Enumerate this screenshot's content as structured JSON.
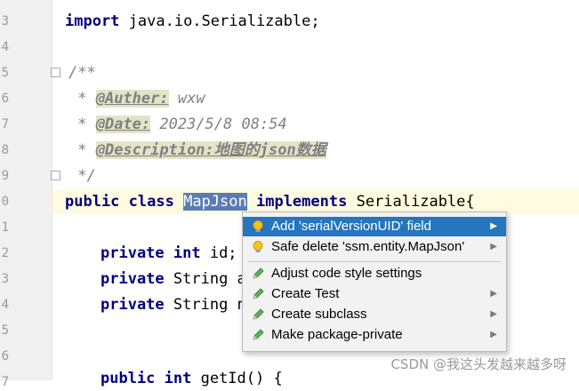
{
  "editor": {
    "line_numbers": [
      "3",
      "4",
      "5",
      "6",
      "7",
      "8",
      "9",
      "0",
      "1",
      "2",
      "3",
      "4",
      "5",
      "6",
      "7"
    ],
    "line3": {
      "kw": "import",
      "rest": " java.io.Serializable;"
    },
    "line5": "/**",
    "line6": {
      "star": " * ",
      "tag": "@Auther:",
      "val": " wxw"
    },
    "line7": {
      "star": " * ",
      "tag": "@Date:",
      "val": " 2023/5/8 08:54"
    },
    "line8": {
      "star": " * ",
      "tag": "@Description:地图的json数据"
    },
    "line9": " */",
    "line10": {
      "kw1": "public class",
      "sel": "MapJson",
      "kw2": "implements",
      "rest": " Serializable{"
    },
    "line12": {
      "kw": "private int",
      "rest": " id;"
    },
    "line13": {
      "kw": "private",
      "rest": " String a"
    },
    "line14": {
      "kw": "private",
      "rest": " String n"
    },
    "line16": {
      "kw": "public int",
      "rest": " getId() {"
    }
  },
  "popup": {
    "items": [
      {
        "label": "Add 'serialVersionUID' field",
        "icon": "bulb-icon",
        "arrow": "▶"
      },
      {
        "label": "Safe delete 'ssm.entity.MapJson'",
        "icon": "bulb-icon",
        "arrow": "▶"
      },
      {
        "label": "Adjust code style settings",
        "icon": "pencil-icon",
        "arrow": ""
      },
      {
        "label": "Create Test",
        "icon": "pencil-icon",
        "arrow": "▶"
      },
      {
        "label": "Create subclass",
        "icon": "pencil-icon",
        "arrow": "▶"
      },
      {
        "label": "Make package-private",
        "icon": "pencil-icon",
        "arrow": "▶"
      }
    ]
  },
  "watermark": "CSDN @我这头发越来越多呀",
  "colors": {
    "selection": "#2675bf",
    "keyword": "#000080",
    "annotation_bg": "#e3e3c7"
  }
}
